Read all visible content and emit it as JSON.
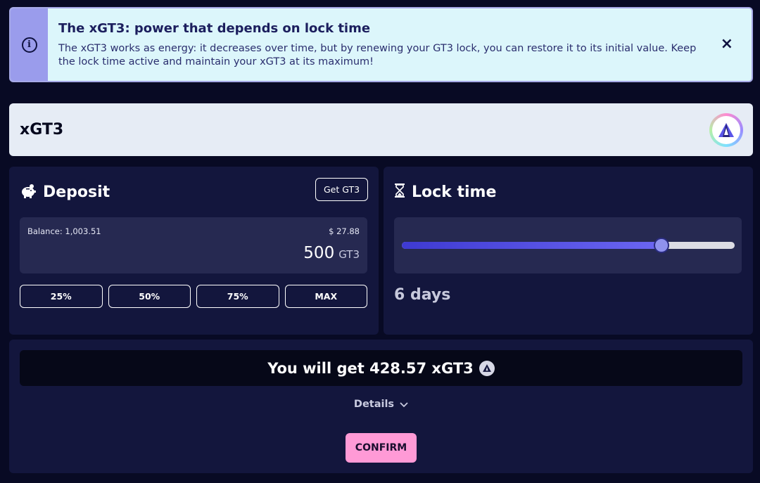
{
  "alert": {
    "title": "The xGT3: power that depends on lock time",
    "text": "The xGT3 works as energy: it decreases over time, but by renewing your GT3 lock, you can restore it to its initial value. Keep the lock time active and maintain your xGT3 at its maximum!",
    "close_icon": "×"
  },
  "token": {
    "title": "xGT3"
  },
  "deposit": {
    "title": "Deposit",
    "get_button": "Get GT3",
    "balance": "Balance: 1,003.51",
    "usd": "$ 27.88",
    "amount": "500",
    "unit": "GT3",
    "percent_buttons": [
      "25%",
      "50%",
      "75%",
      "MAX"
    ]
  },
  "lock": {
    "title": "Lock time",
    "value": "6 days",
    "slider_fraction": 0.78
  },
  "result": {
    "text": "You will get 428.57 xGT3",
    "details_label": "Details",
    "confirm_label": "CONFIRM"
  },
  "colors": {
    "background": "#080a24",
    "card": "#13163d",
    "accent": "#4b46e0",
    "confirm": "#ff9ad6"
  }
}
